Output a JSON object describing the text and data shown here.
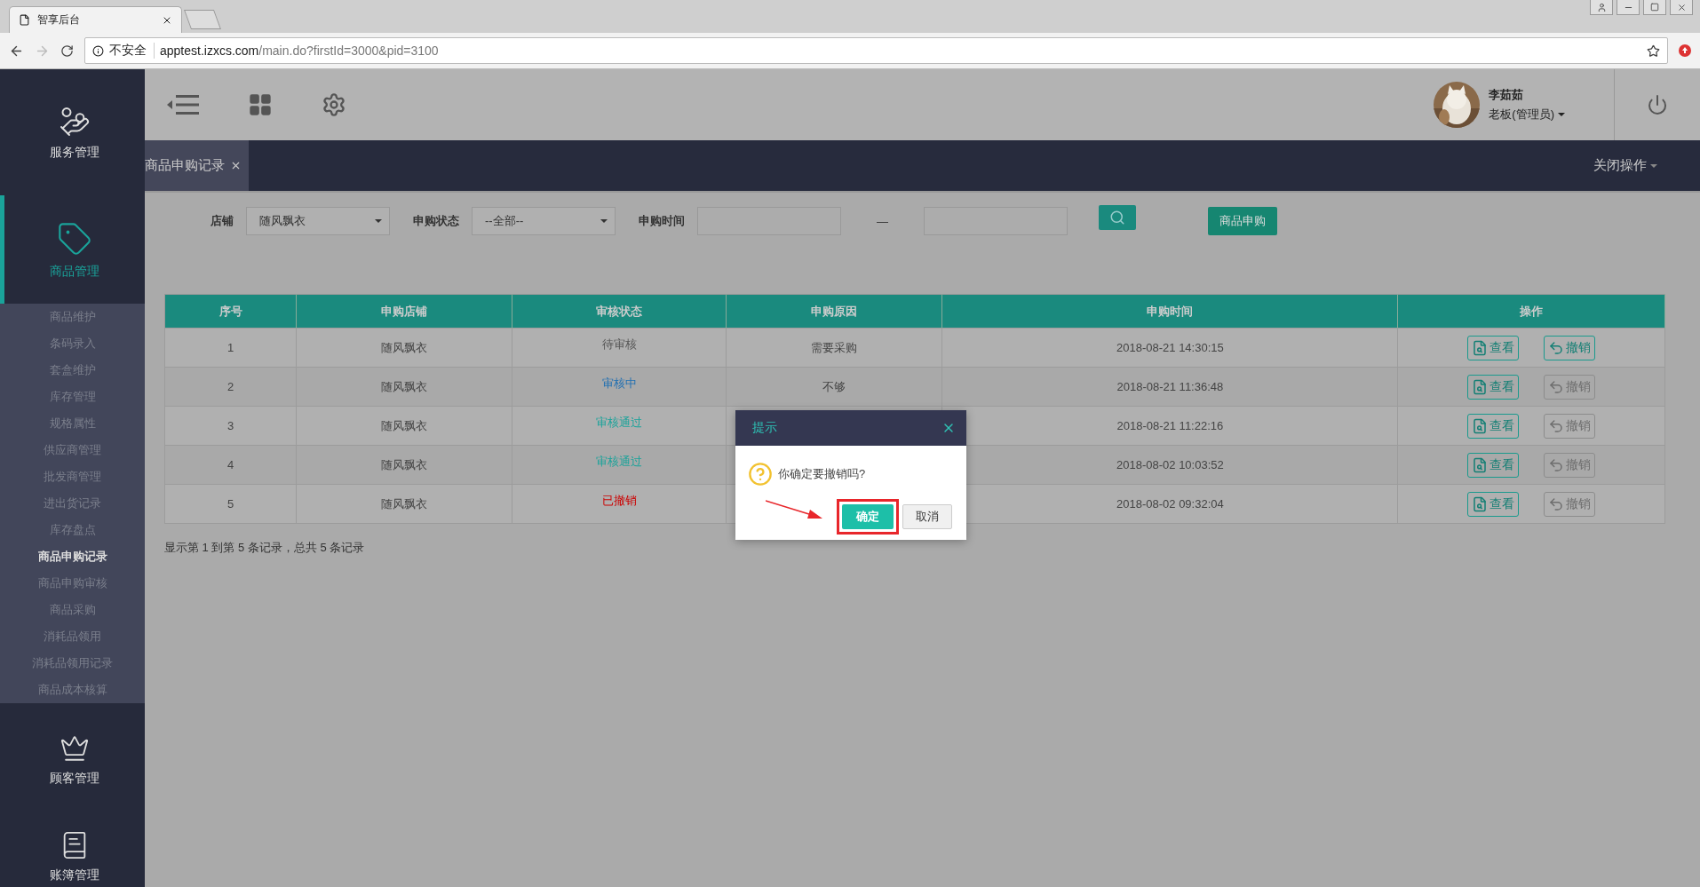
{
  "browser": {
    "tab_title": "智享后台",
    "security": "不安全",
    "url_host": "apptest.izxcs.com",
    "url_path": "/main.do?firstId=3000&pid=3100"
  },
  "sidebar": {
    "sections": [
      {
        "label": "服务管理",
        "kind": "service",
        "selected": false
      },
      {
        "label": "商品管理",
        "kind": "sale",
        "selected": true,
        "items": [
          {
            "label": "商品维护",
            "selected": false
          },
          {
            "label": "条码录入",
            "selected": false
          },
          {
            "label": "套盒维护",
            "selected": false
          },
          {
            "label": "库存管理",
            "selected": false
          },
          {
            "label": "规格属性",
            "selected": false
          },
          {
            "label": "供应商管理",
            "selected": false
          },
          {
            "label": "批发商管理",
            "selected": false
          },
          {
            "label": "进出货记录",
            "selected": false
          },
          {
            "label": "库存盘点",
            "selected": false
          },
          {
            "label": "商品申购记录",
            "selected": true
          },
          {
            "label": "商品申购审核",
            "selected": false
          },
          {
            "label": "商品采购",
            "selected": false
          },
          {
            "label": "消耗品领用",
            "selected": false
          },
          {
            "label": "消耗品领用记录",
            "selected": false
          },
          {
            "label": "商品成本核算",
            "selected": false
          }
        ]
      },
      {
        "label": "顾客管理",
        "kind": "crown",
        "selected": false
      },
      {
        "label": "账簿管理",
        "kind": "ledger",
        "selected": false
      }
    ]
  },
  "header": {
    "user_name": "李茹茹",
    "user_role": "老板(管理员)"
  },
  "tabs": [
    {
      "label": "商品申购记录",
      "selected": true
    }
  ],
  "close_menu": "关闭操作",
  "filters": {
    "store_label": "店铺",
    "store_value": "随风飘衣",
    "status_label": "申购状态",
    "status_value": "--全部--",
    "time_label": "申购时间",
    "time_separator": "—",
    "apply_button": "商品申购"
  },
  "table": {
    "columns": [
      "序号",
      "申购店铺",
      "审核状态",
      "申购原因",
      "申购时间",
      "操作"
    ],
    "rows": [
      {
        "index": "1",
        "store": "随风飘衣",
        "status": {
          "text": "待审核",
          "color": "#555555"
        },
        "reason": "需要采购",
        "time": "2018-08-21 14:30:15",
        "actions": [
          {
            "label": "查看",
            "kind": "view",
            "disabled": false
          },
          {
            "label": "撤销",
            "kind": "revoke",
            "disabled": false
          }
        ]
      },
      {
        "index": "2",
        "store": "随风飘衣",
        "status": {
          "text": "审核中",
          "color": "#1f6fb2"
        },
        "reason": "不够",
        "time": "2018-08-21 11:36:48",
        "actions": [
          {
            "label": "查看",
            "kind": "view",
            "disabled": false
          },
          {
            "label": "撤销",
            "kind": "revoke",
            "disabled": true
          }
        ]
      },
      {
        "index": "3",
        "store": "随风飘衣",
        "status": {
          "text": "审核通过",
          "color": "#1aa39a"
        },
        "time": "2018-08-21 11:22:16",
        "actions": [
          {
            "label": "查看",
            "kind": "view",
            "disabled": false
          },
          {
            "label": "撤销",
            "kind": "revoke",
            "disabled": true
          }
        ]
      },
      {
        "index": "4",
        "store": "随风飘衣",
        "status": {
          "text": "审核通过",
          "color": "#1aa39a"
        },
        "time": "2018-08-02 10:03:52",
        "actions": [
          {
            "label": "查看",
            "kind": "view",
            "disabled": false
          },
          {
            "label": "撤销",
            "kind": "revoke",
            "disabled": true
          }
        ]
      },
      {
        "index": "5",
        "store": "随风飘衣",
        "status": {
          "text": "已撤销",
          "color": "#cc0000"
        },
        "time": "2018-08-02 09:32:04",
        "actions": [
          {
            "label": "查看",
            "kind": "view",
            "disabled": false
          },
          {
            "label": "撤销",
            "kind": "revoke",
            "disabled": true
          }
        ]
      }
    ],
    "summary": "显示第 1 到第 5 条记录，总共 5 条记录"
  },
  "dialog": {
    "title": "提示",
    "message": "你确定要撤销吗?",
    "confirm": "确定",
    "cancel": "取消",
    "confirm_highlighted": true
  }
}
